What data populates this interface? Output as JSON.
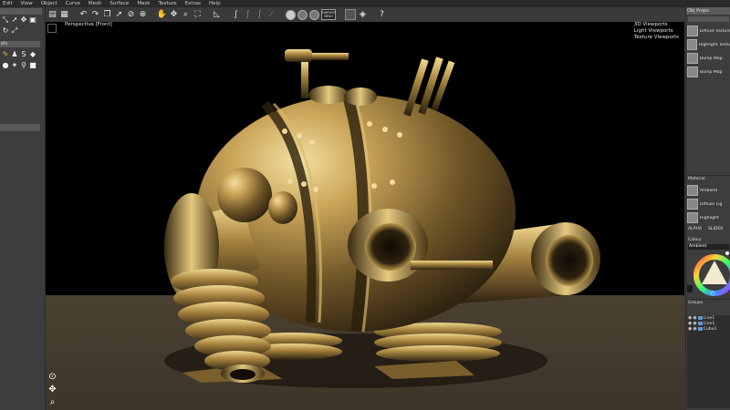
{
  "menu": [
    "Edit",
    "View",
    "Object",
    "Curve",
    "Mesh",
    "Surface",
    "Mask",
    "Texture",
    "Extras",
    "Help"
  ],
  "left_panel": {
    "tab_label": "ols"
  },
  "toolbar": {
    "badge_line1": "SURFACE",
    "badge_line2": "MESH"
  },
  "viewport": {
    "label": "Perspective [Front]",
    "links": [
      "3D Viewports",
      "Light Viewports",
      "Texture Viewports"
    ]
  },
  "right_panel": {
    "obj_header": "Obj Props",
    "obj_slots": [
      "Diffuse Texture",
      "Highlight Texture",
      "Bump Map",
      "Bump Map"
    ],
    "material_header": "Material",
    "material_slots": [
      "Ambient",
      "Diffuse Lig",
      "Highlight"
    ],
    "alpha_label": "ALPHA",
    "slider_label": "SLIDER",
    "colour_label": "Colour",
    "colour_value": "Ambient",
    "groups_label": "Groups",
    "groups": [
      "Line1",
      "Line1",
      "Cube1"
    ]
  },
  "colors": {
    "accent": "#5e9bd1",
    "brass": "#b8954a",
    "viewport_bg": "#000000",
    "floor": "#463e30"
  }
}
